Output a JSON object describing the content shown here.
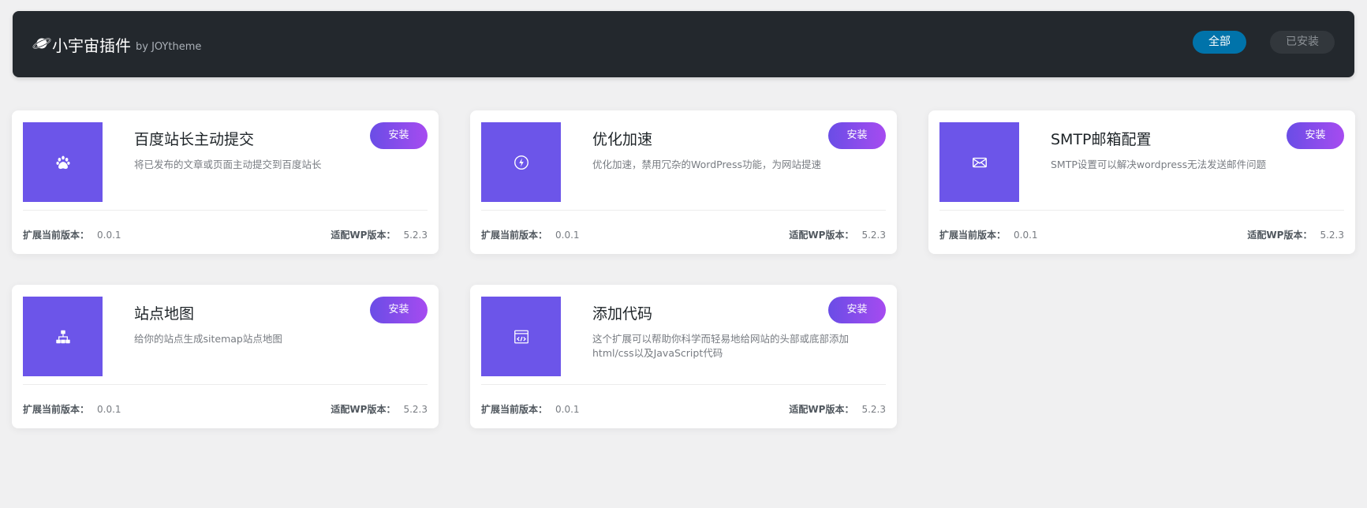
{
  "header": {
    "title": "小宇宙插件",
    "by": "by JOYtheme",
    "filters": {
      "all": "全部",
      "installed": "已安装"
    },
    "colors": {
      "bg": "#23282d",
      "active": "#0073aa"
    }
  },
  "labels": {
    "current_version": "扩展当前版本：",
    "wp_version": "适配WP版本："
  },
  "plugins": [
    {
      "title": "百度站长主动提交",
      "desc": "将已发布的文章或页面主动提交到百度站长",
      "button": "安装",
      "version": "0.0.1",
      "wp": "5.2.3",
      "icon": "paw-icon"
    },
    {
      "title": "优化加速",
      "desc": "优化加速，禁用冗杂的WordPress功能，为网站提速",
      "button": "安装",
      "version": "0.0.1",
      "wp": "5.2.3",
      "icon": "bolt-icon"
    },
    {
      "title": "SMTP邮箱配置",
      "desc": "SMTP设置可以解决wordpress无法发送邮件问题",
      "button": "安装",
      "version": "0.0.1",
      "wp": "5.2.3",
      "icon": "envelope-icon"
    },
    {
      "title": "站点地图",
      "desc": "给你的站点生成sitemap站点地图",
      "button": "安装",
      "version": "0.0.1",
      "wp": "5.2.3",
      "icon": "sitemap-icon"
    },
    {
      "title": "添加代码",
      "desc": "这个扩展可以帮助你科学而轻易地给网站的头部或底部添加html/css以及JavaScript代码",
      "button": "安装",
      "version": "0.0.1",
      "wp": "5.2.3",
      "icon": "code-window-icon"
    }
  ],
  "accent_colors": {
    "thumb": "#6c55e9",
    "button_from": "#6a4de6",
    "button_to": "#a64bf0"
  }
}
